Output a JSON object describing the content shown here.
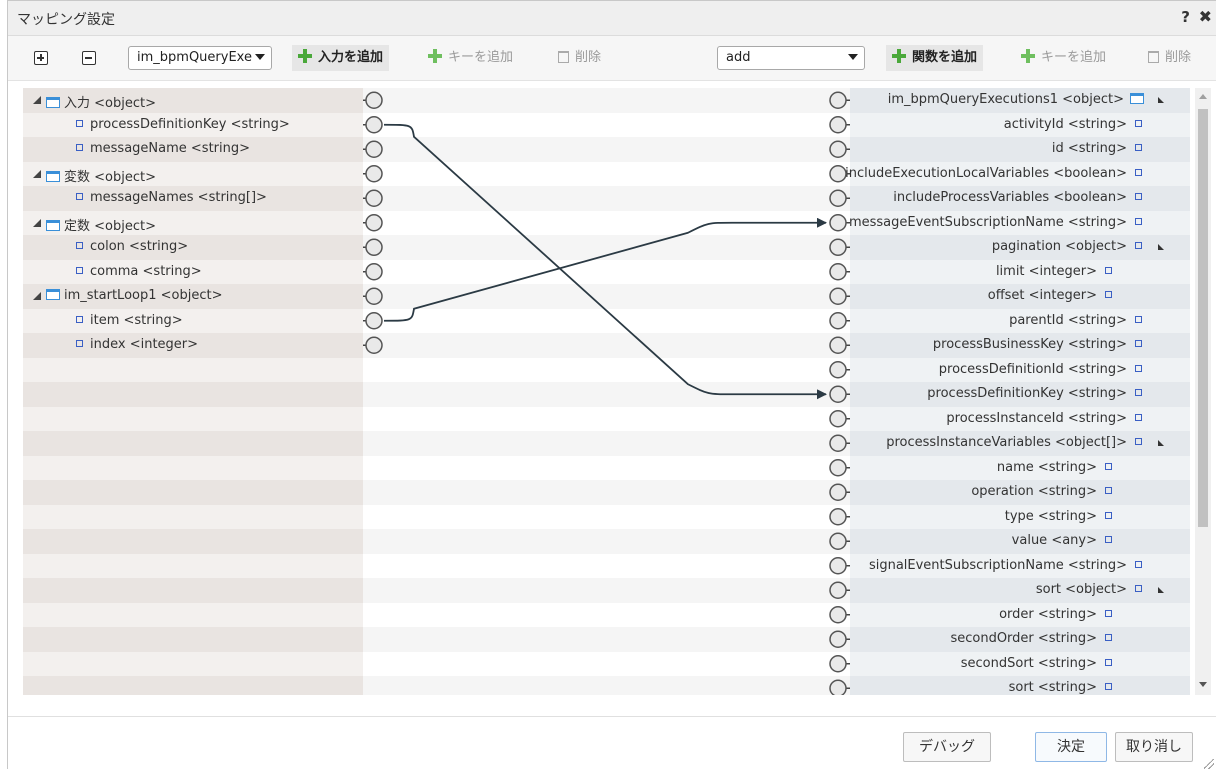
{
  "dialog": {
    "title": "マッピング設定",
    "help": "?",
    "close": "✖"
  },
  "toolbar": {
    "source_select": "im_bpmQueryExe",
    "add_input": "入力を追加",
    "add_key_left": "キーを追加",
    "delete_left": "削除",
    "function_select": "add",
    "add_function": "関数を追加",
    "add_key_right": "キーを追加",
    "delete_right": "削除"
  },
  "left_rows": [
    {
      "label": "入力 <object>",
      "type": "object"
    },
    {
      "label": "processDefinitionKey <string>",
      "type": "prop"
    },
    {
      "label": "messageName <string>",
      "type": "prop"
    },
    {
      "label": "変数 <object>",
      "type": "object"
    },
    {
      "label": "messageNames <string[]>",
      "type": "prop"
    },
    {
      "label": "定数 <object>",
      "type": "object"
    },
    {
      "label": "colon <string>",
      "type": "prop"
    },
    {
      "label": "comma <string>",
      "type": "prop"
    },
    {
      "label": "im_startLoop1 <object>",
      "type": "object"
    },
    {
      "label": "item <string>",
      "type": "prop"
    },
    {
      "label": "index <integer>",
      "type": "prop"
    }
  ],
  "right_rows": [
    {
      "label": "im_bpmQueryExecutions1 <object>",
      "type": "root"
    },
    {
      "label": "activityId <string>",
      "type": "prop",
      "level": 1
    },
    {
      "label": "id <string>",
      "type": "prop",
      "level": 1
    },
    {
      "label": "includeExecutionLocalVariables <boolean>",
      "type": "prop",
      "level": 1
    },
    {
      "label": "includeProcessVariables <boolean>",
      "type": "prop",
      "level": 1
    },
    {
      "label": "messageEventSubscriptionName <string>",
      "type": "prop",
      "level": 1
    },
    {
      "label": "pagination <object>",
      "type": "object",
      "level": 1
    },
    {
      "label": "limit <integer>",
      "type": "prop",
      "level": 2
    },
    {
      "label": "offset <integer>",
      "type": "prop",
      "level": 2
    },
    {
      "label": "parentId <string>",
      "type": "prop",
      "level": 1
    },
    {
      "label": "processBusinessKey <string>",
      "type": "prop",
      "level": 1
    },
    {
      "label": "processDefinitionId <string>",
      "type": "prop",
      "level": 1
    },
    {
      "label": "processDefinitionKey <string>",
      "type": "prop",
      "level": 1
    },
    {
      "label": "processInstanceId <string>",
      "type": "prop",
      "level": 1
    },
    {
      "label": "processInstanceVariables <object[]>",
      "type": "object",
      "level": 1
    },
    {
      "label": "name <string>",
      "type": "prop",
      "level": 2
    },
    {
      "label": "operation <string>",
      "type": "prop",
      "level": 2
    },
    {
      "label": "type <string>",
      "type": "prop",
      "level": 2
    },
    {
      "label": "value <any>",
      "type": "prop",
      "level": 2
    },
    {
      "label": "signalEventSubscriptionName <string>",
      "type": "prop",
      "level": 1
    },
    {
      "label": "sort <object>",
      "type": "object",
      "level": 1
    },
    {
      "label": "order <string>",
      "type": "prop",
      "level": 2
    },
    {
      "label": "secondOrder <string>",
      "type": "prop",
      "level": 2
    },
    {
      "label": "secondSort <string>",
      "type": "prop",
      "level": 2
    },
    {
      "label": "sort <string>",
      "type": "prop",
      "level": 2
    }
  ],
  "mappings": [
    {
      "from": "processDefinitionKey <string>",
      "to": "processDefinitionKey <string>"
    },
    {
      "from": "item <string>",
      "to": "messageEventSubscriptionName <string>"
    }
  ],
  "footer": {
    "debug": "デバッグ",
    "ok": "決定",
    "cancel": "取り消し"
  },
  "colors": {
    "wire": "#2b3a44",
    "object_icon": "#3a8fd8",
    "prop_icon": "#3a5fc4",
    "add_icon": "#4aa83a"
  }
}
